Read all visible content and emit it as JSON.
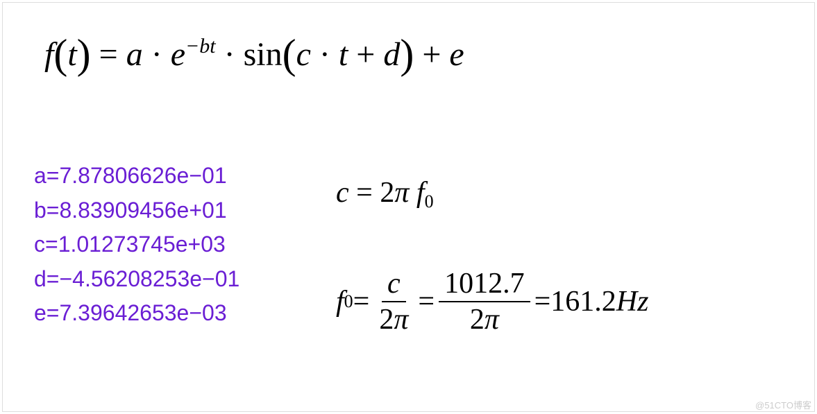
{
  "equation_main": {
    "lhs_f": "f",
    "lparen1": "(",
    "t": "t",
    "rparen1": ")",
    "eq": " = ",
    "a": "a",
    "dot1": " · ",
    "e1": "e",
    "exp": "−bt",
    "dot2": " · ",
    "sin": "sin",
    "lparen2": "(",
    "c": "c",
    "dot3": " · ",
    "t2": "t",
    "plus": " + ",
    "d": "d",
    "rparen2": ")",
    "plus2": " + ",
    "e2": "e"
  },
  "params": {
    "a": "a=7.87806626e−01",
    "b": "b=8.83909456e+01",
    "c": "c=1.01273745e+03",
    "d": "d=−4.56208253e−01",
    "e": "e=7.39642653e−03"
  },
  "eq_c": {
    "c": "c",
    "eq": " = ",
    "two": "2",
    "pi": "π",
    "f": " f",
    "sub0": "0"
  },
  "eq_f0": {
    "f": "f",
    "sub0": "0",
    "eq1": " = ",
    "frac1_num": "c",
    "frac1_den_2": "2",
    "frac1_den_pi": "π",
    "eq2": " = ",
    "frac2_num": "1012.7",
    "frac2_den_2": "2",
    "frac2_den_pi": "π",
    "eq3": " = ",
    "result_num": "161.2",
    "result_unit": "Hz"
  },
  "watermark": "@51CTO博客"
}
